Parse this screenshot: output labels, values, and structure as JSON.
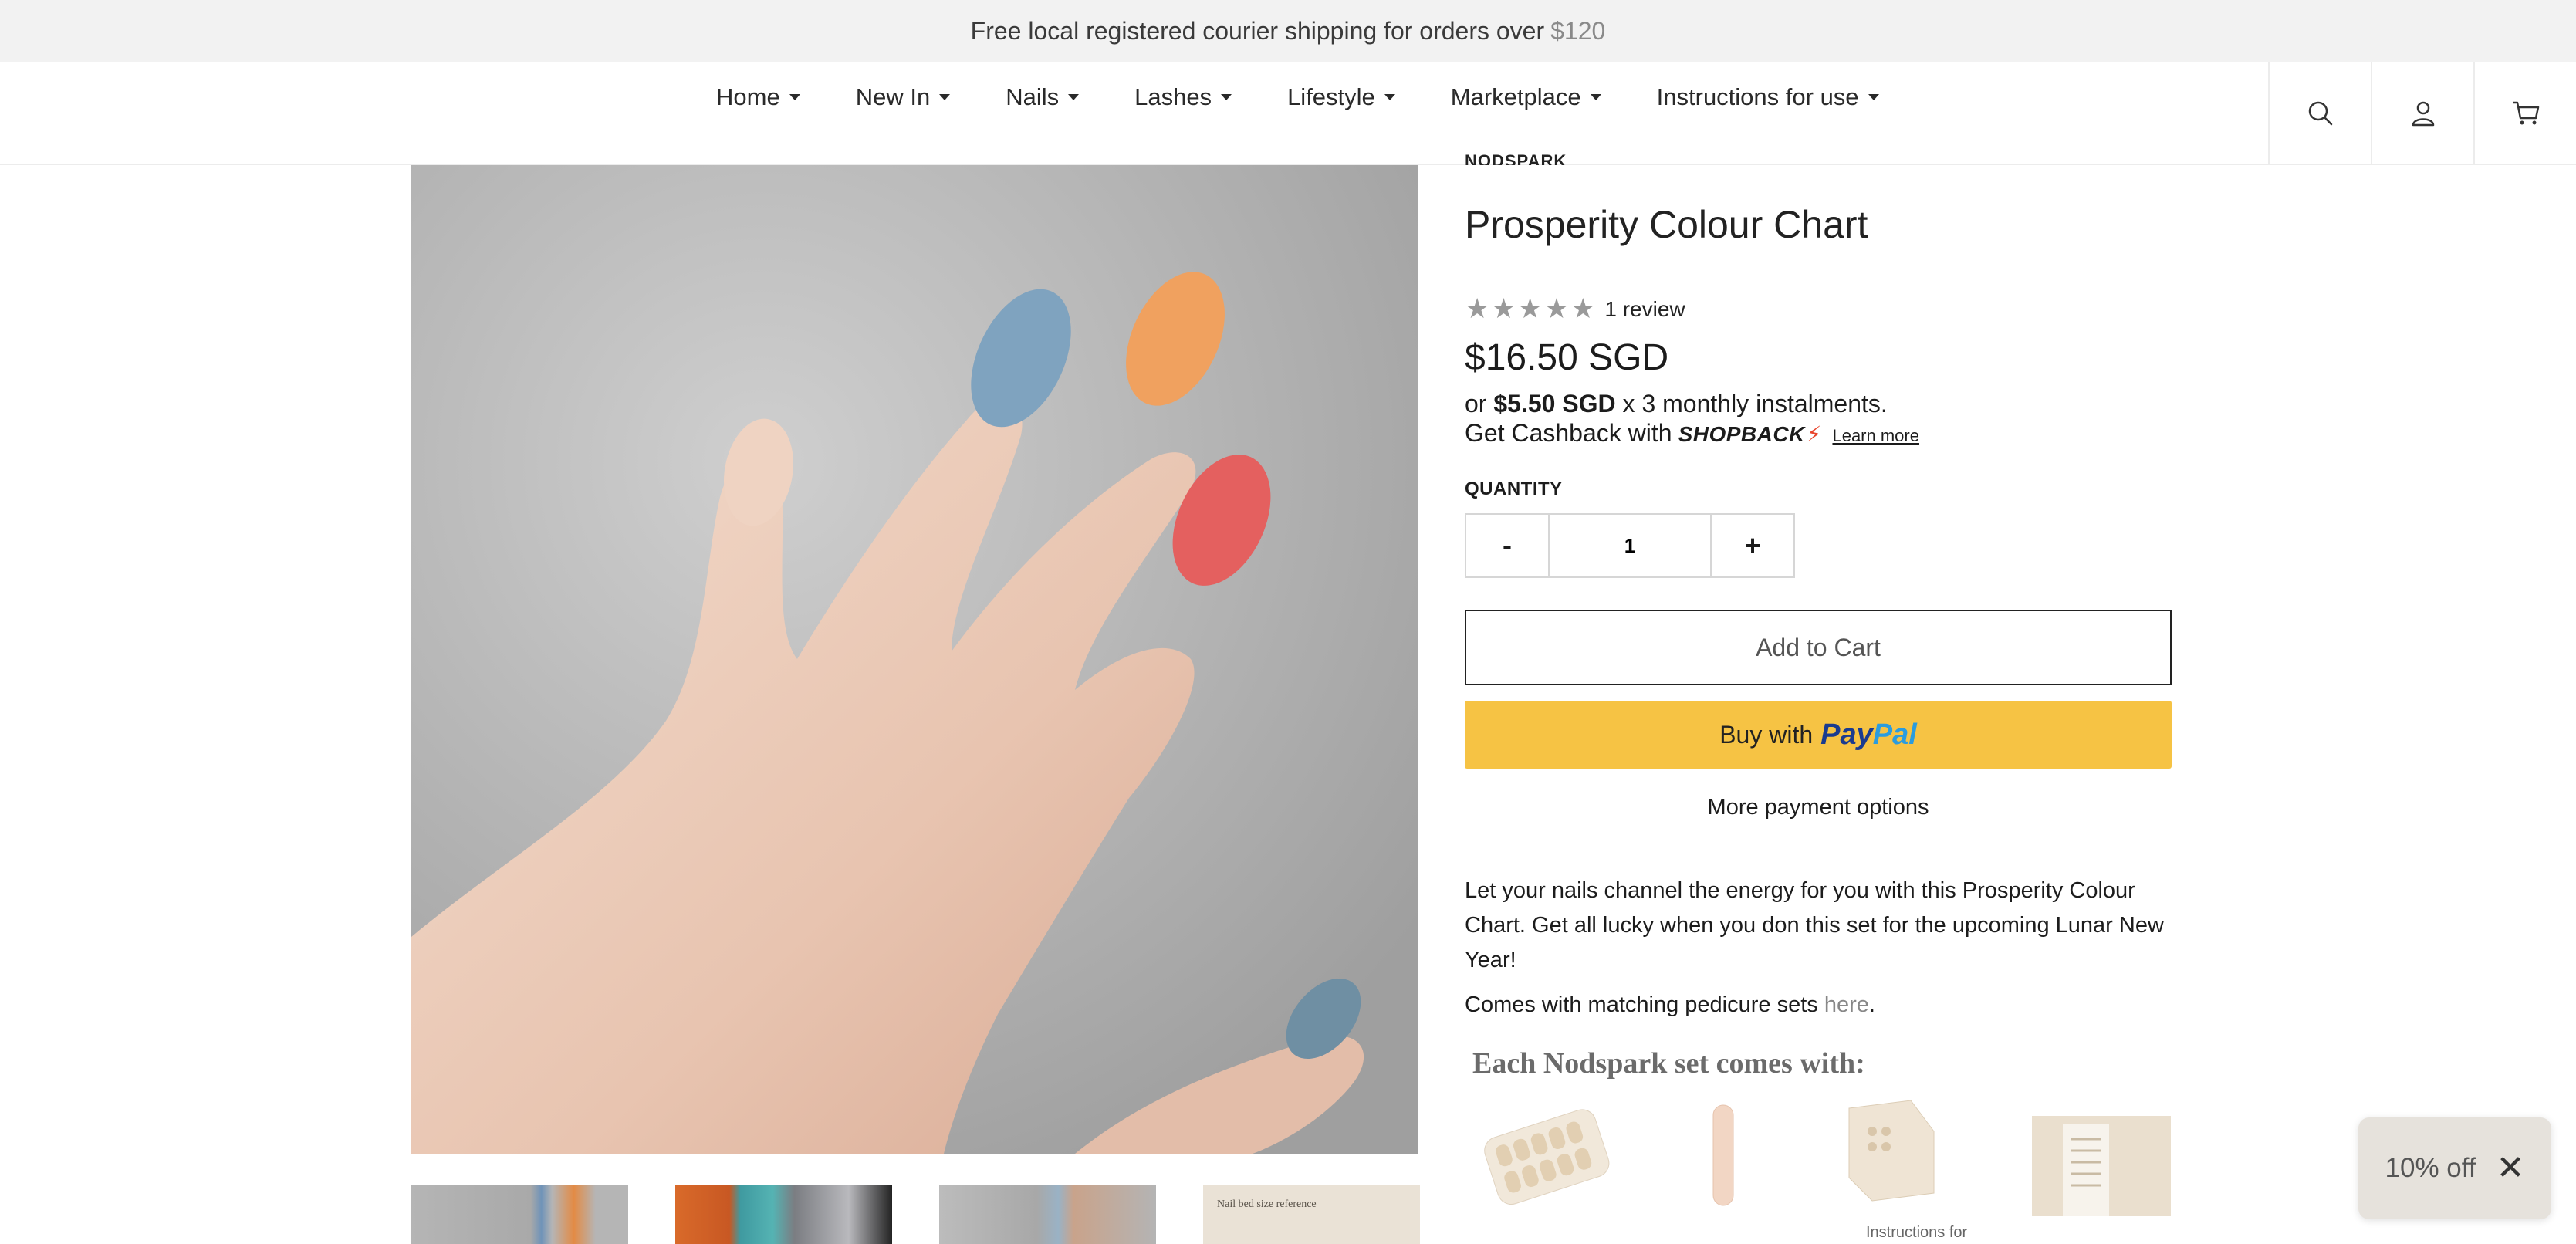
{
  "announcement": {
    "text": "Free local registered courier shipping for orders over",
    "accent": "$120"
  },
  "nav": {
    "items": [
      {
        "label": "Home"
      },
      {
        "label": "New In"
      },
      {
        "label": "Nails"
      },
      {
        "label": "Lashes"
      },
      {
        "label": "Lifestyle"
      },
      {
        "label": "Marketplace"
      },
      {
        "label": "Instructions for use"
      }
    ],
    "icons": [
      "search-icon",
      "account-icon",
      "cart-icon"
    ]
  },
  "product": {
    "vendor": "NODSPARK",
    "title": "Prosperity Colour Chart",
    "stars": "★★★★★",
    "rating": 5,
    "review_count": "1 review",
    "price": "$16.50 SGD",
    "instalment": {
      "prefix": "or",
      "amount": "$5.50 SGD",
      "suffix": "x 3 monthly instalments."
    },
    "cashback": {
      "prefix": "Get Cashback with",
      "brand": "SHOPBACK",
      "bolt": "⚡",
      "learn_more": "Learn more"
    },
    "quantity_label": "QUANTITY",
    "quantity": {
      "minus": "-",
      "value": "1",
      "plus": "+"
    },
    "add_to_cart": "Add to Cart",
    "paypal": {
      "prefix": "Buy with",
      "brand_a": "Pay",
      "brand_b": "Pal"
    },
    "more_payment": "More payment options",
    "description": "Let your nails channel the energy for you with this Prosperity Colour Chart. Get all lucky when you don this set for the upcoming Lunar New Year!",
    "pedicure": {
      "text": "Comes with matching pedicure sets",
      "link": "here",
      "end": "."
    },
    "kit": {
      "title": "Each Nodspark set comes with:",
      "caption": "Instructions for"
    }
  },
  "thumbnails": [
    {
      "name": "thumb-hand-1"
    },
    {
      "name": "thumb-packaging"
    },
    {
      "name": "thumb-hand-2"
    },
    {
      "name": "thumb-size-reference",
      "text": "Nail bed size reference"
    }
  ],
  "popup": {
    "label": "10% off",
    "close": "✕"
  },
  "colors": {
    "announcement_bg": "#f2f2f2",
    "paypal_button": "#f6c344",
    "nail_blue": "#7fa3bf",
    "nail_orange": "#f0a15f",
    "nail_red": "#e4605f",
    "nail_nude": "#efd3c2"
  }
}
